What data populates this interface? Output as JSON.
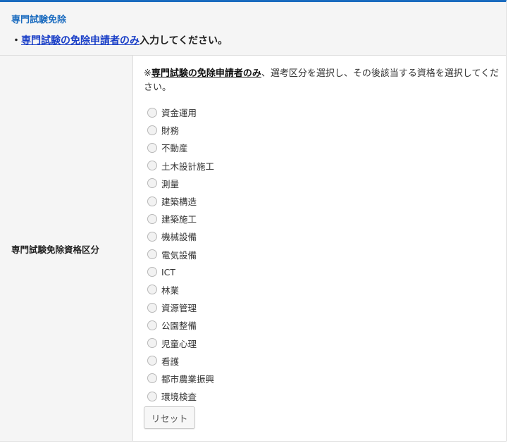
{
  "section": {
    "title": "専門試験免除",
    "note_bullet": "・",
    "note_link": "専門試験の免除申請者のみ",
    "note_rest": "入力してください。"
  },
  "field": {
    "label": "専門試験免除資格区分",
    "instruction_prefix": "※",
    "instruction_emphasis": "専門試験の免除申請者のみ",
    "instruction_rest": "、選考区分を選択し、その後該当する資格を選択してください。"
  },
  "options": [
    "資金運用",
    "財務",
    "不動産",
    "土木設計施工",
    "測量",
    "建築構造",
    "建築施工",
    "機械設備",
    "電気設備",
    "ICT",
    "林業",
    "資源管理",
    "公園整備",
    "児童心理",
    "看護",
    "都市農業振興",
    "環境検査"
  ],
  "reset_label": "リセット",
  "colors": {
    "accent": "#1a6bbf",
    "link": "#1a3fc7",
    "header_bg": "#f5f5f5"
  }
}
